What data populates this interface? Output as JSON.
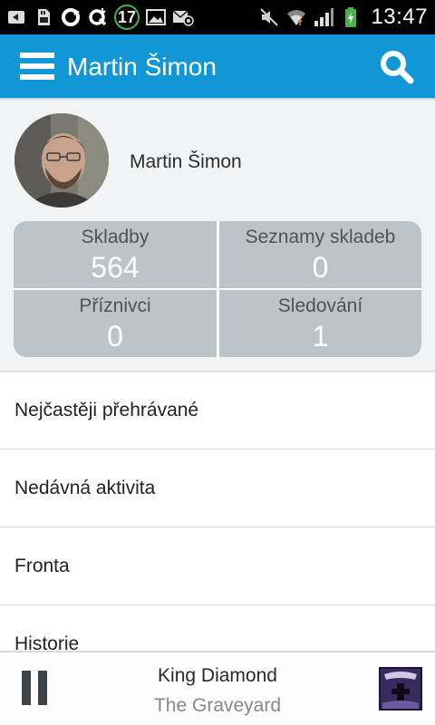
{
  "statusbar": {
    "notification_count": "17",
    "time": "13:47",
    "icons": [
      "back-notify-icon",
      "sd-card-icon",
      "app-o-icon",
      "download-q-icon",
      "image-icon",
      "mail-at-icon",
      "mute-icon",
      "wifi-icon",
      "signal-icon",
      "battery-charging-icon"
    ]
  },
  "appbar": {
    "title": "Martin Šimon",
    "menu_icon": "hamburger-icon",
    "search_icon": "search-icon"
  },
  "profile": {
    "name": "Martin Šimon",
    "stats": [
      {
        "label": "Skladby",
        "value": "564"
      },
      {
        "label": "Seznamy skladeb",
        "value": "0"
      },
      {
        "label": "Příznivci",
        "value": "0"
      },
      {
        "label": "Sledování",
        "value": "1"
      }
    ]
  },
  "menu": {
    "items": [
      {
        "label": "Nejčastěji přehrávané"
      },
      {
        "label": "Nedávná aktivita"
      },
      {
        "label": "Fronta"
      },
      {
        "label": "Historie"
      }
    ]
  },
  "player": {
    "artist": "King Diamond",
    "album": "The Graveyard",
    "state_icon": "pause-icon"
  },
  "colors": {
    "appbar": "#1297d6",
    "stat_tile": "#bcc4ca",
    "background": "#f2f3f5"
  }
}
